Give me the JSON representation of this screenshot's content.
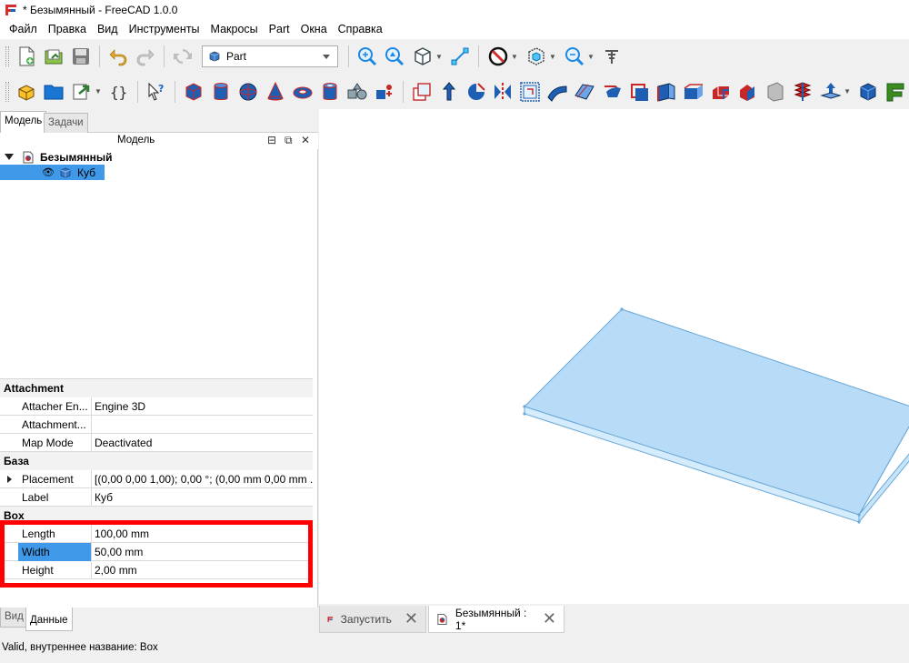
{
  "window": {
    "title": "* Безымянный - FreeCAD 1.0.0"
  },
  "menu": [
    "Файл",
    "Правка",
    "Вид",
    "Инструменты",
    "Макросы",
    "Part",
    "Окна",
    "Справка"
  ],
  "toolbar1": {
    "workbench": "Part",
    "icons": [
      "new-file-icon",
      "open-file-icon",
      "save-icon",
      "undo-icon",
      "redo-icon",
      "refresh-icon",
      "fit-all-icon",
      "fit-selection-icon",
      "isometric-view-icon",
      "measure-icon",
      "draw-style-icon",
      "bounding-box-icon",
      "zoom-icon",
      "whats-this-icon"
    ]
  },
  "toolbar2": {
    "icons": [
      "part-icon",
      "group-icon",
      "link-icon",
      "var-set-icon",
      "whats-this-icon",
      "cube-icon",
      "cylinder-icon",
      "sphere-icon",
      "cone-icon",
      "torus-icon",
      "tube-icon",
      "primitives-icon",
      "shape-builder-icon",
      "extrude-icon",
      "revolve-icon",
      "mirror-icon",
      "fillet-icon",
      "chamfer-icon",
      "make-face-icon",
      "ruled-surface-icon",
      "loft-icon",
      "sweep-icon",
      "section-icon",
      "cross-sections-icon",
      "offset-icon",
      "thickness-icon",
      "projection-icon",
      "compound-icon",
      "box-select-icon"
    ]
  },
  "combo": {
    "tabs": [
      "Модель",
      "Задачи"
    ],
    "header": "Модель",
    "tree": {
      "root": "Безымянный",
      "child": "Куб"
    },
    "properties": {
      "groups": [
        {
          "name": "Attachment",
          "rows": [
            {
              "key": "Attacher En...",
              "value": "Engine 3D"
            },
            {
              "key": "Attachment...",
              "value": ""
            },
            {
              "key": "Map Mode",
              "value": "Deactivated"
            }
          ]
        },
        {
          "name": "База",
          "rows": [
            {
              "key": "Placement",
              "value": "[(0,00 0,00 1,00); 0,00 °; (0,00 mm  0,00 mm ..."
            },
            {
              "key": "Label",
              "value": "Куб"
            }
          ]
        },
        {
          "name": "Box",
          "rows": [
            {
              "key": "Length",
              "value": "100,00 mm"
            },
            {
              "key": "Width",
              "value": "50,00 mm"
            },
            {
              "key": "Height",
              "value": "2,00 mm"
            }
          ]
        }
      ]
    },
    "bottom_tabs": [
      "Вид",
      "Данные"
    ]
  },
  "doc_tabs": [
    {
      "label": "Запустить"
    },
    {
      "label": "Безымянный : 1*"
    }
  ],
  "status": "Valid, внутреннее название: Box",
  "colors": {
    "selection": "#3f98e8",
    "highlight": "#ff0000",
    "box_face": "#b8dcf8"
  }
}
